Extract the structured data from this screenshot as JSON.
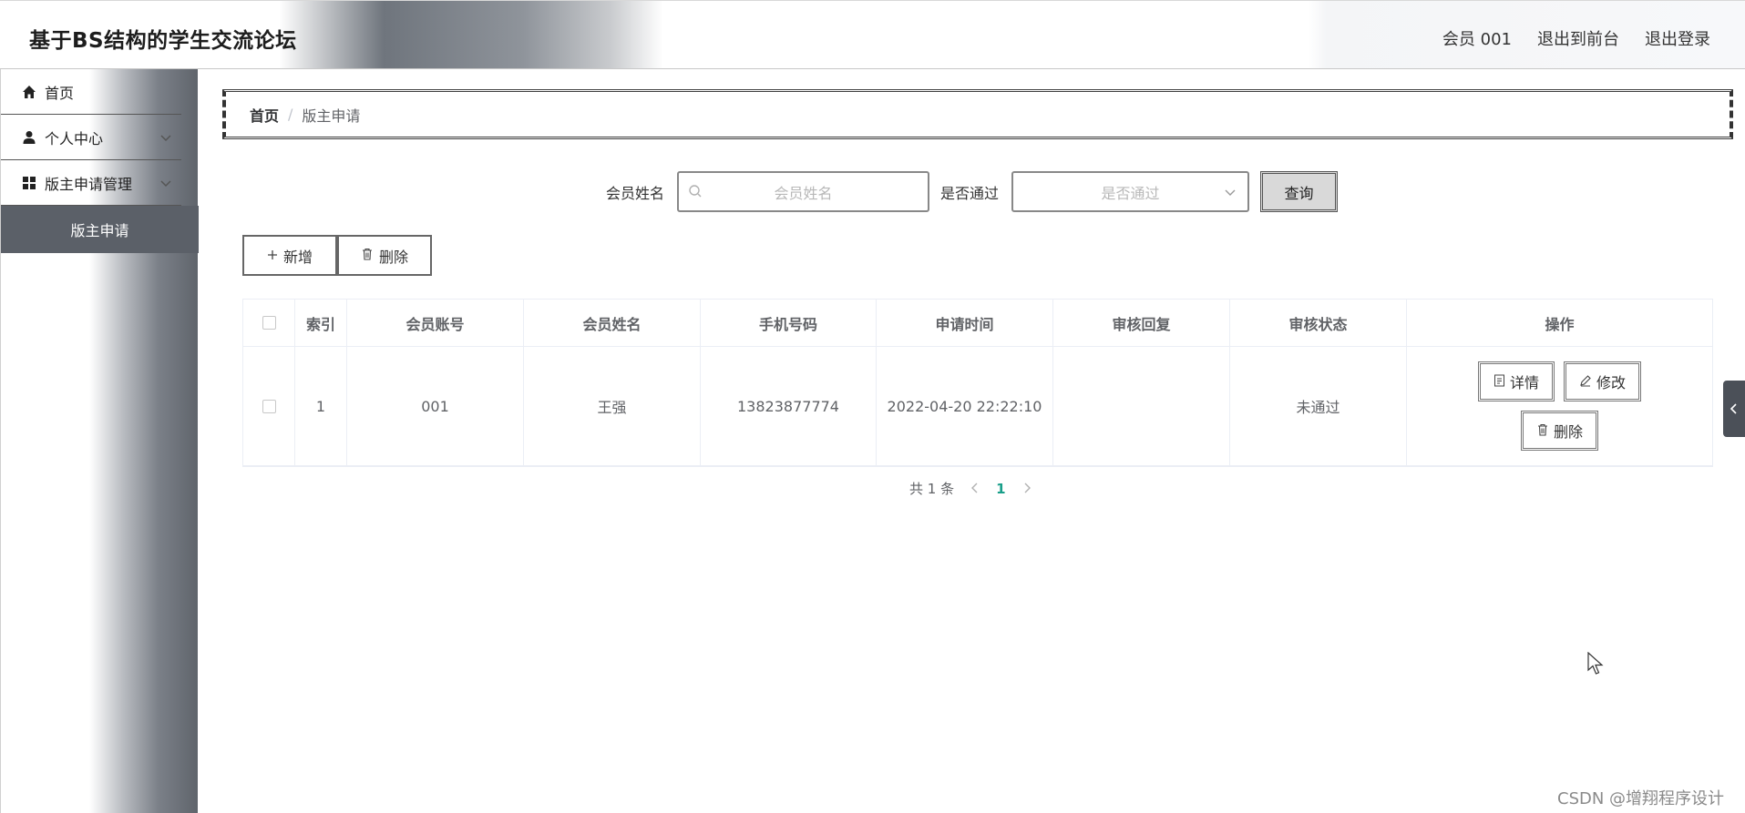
{
  "header": {
    "title": "基于BS结构的学生交流论坛",
    "user": "会员 001",
    "to_front": "退出到前台",
    "logout": "退出登录"
  },
  "sidebar": {
    "items": [
      {
        "label": "首页",
        "icon": "home-icon"
      },
      {
        "label": "个人中心",
        "icon": "user-icon"
      },
      {
        "label": "版主申请管理",
        "icon": "grid-icon"
      }
    ],
    "sub_item": "版主申请"
  },
  "breadcrumb": {
    "home": "首页",
    "separator": "/",
    "current": "版主申请"
  },
  "search": {
    "name_label": "会员姓名",
    "name_placeholder": "会员姓名",
    "pass_label": "是否通过",
    "pass_placeholder": "是否通过",
    "query_button": "查询"
  },
  "actions": {
    "add": "新增",
    "delete": "删除"
  },
  "table": {
    "headers": [
      "索引",
      "会员账号",
      "会员姓名",
      "手机号码",
      "申请时间",
      "审核回复",
      "审核状态",
      "操作"
    ],
    "rows": [
      {
        "index": "1",
        "account": "001",
        "name": "王强",
        "phone": "13823877774",
        "time": "2022-04-20 22:22:10",
        "reply": "",
        "status": "未通过",
        "ops": {
          "detail": "详情",
          "edit": "修改",
          "delete": "删除"
        }
      }
    ]
  },
  "pager": {
    "total": "共 1 条",
    "current_page": "1"
  },
  "watermark": "CSDN @增翔程序设计",
  "colors": {
    "accent": "#1a9f8a",
    "sidebar_active": "#5b6068"
  }
}
